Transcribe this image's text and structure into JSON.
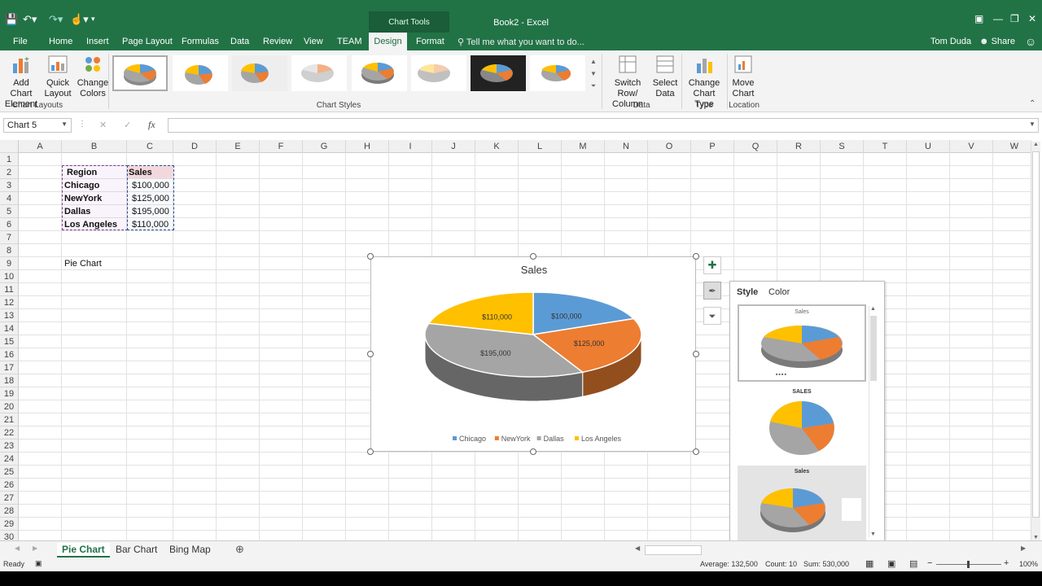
{
  "window": {
    "title": "Book2 - Excel",
    "context_group": "Chart Tools",
    "user": "Tom Duda",
    "share_label": "Share"
  },
  "tabs": [
    {
      "label": "File"
    },
    {
      "label": "Home"
    },
    {
      "label": "Insert"
    },
    {
      "label": "Page Layout"
    },
    {
      "label": "Formulas"
    },
    {
      "label": "Data"
    },
    {
      "label": "Review"
    },
    {
      "label": "View"
    },
    {
      "label": "TEAM"
    },
    {
      "label": "Design"
    },
    {
      "label": "Format"
    }
  ],
  "tell_me": "Tell me what you want to do...",
  "ribbon": {
    "add_chart_element": "Add Chart Element",
    "quick_layout": "Quick Layout",
    "change_colors": "Change Colors",
    "group_chart_layouts": "Chart Layouts",
    "group_chart_styles": "Chart Styles",
    "switch_row_column": "Switch Row/ Column",
    "select_data": "Select Data",
    "group_data": "Data",
    "change_chart_type": "Change Chart Type",
    "group_type": "Type",
    "move_chart": "Move Chart",
    "group_location": "Location"
  },
  "formula_bar": {
    "name_box": "Chart 5",
    "fx": "fx",
    "content": ""
  },
  "columns": [
    "A",
    "B",
    "C",
    "D",
    "E",
    "F",
    "G",
    "H",
    "I",
    "J",
    "K",
    "L",
    "M",
    "N",
    "O",
    "P",
    "Q",
    "R",
    "S",
    "T",
    "U",
    "V",
    "W"
  ],
  "rows": [
    "1",
    "2",
    "3",
    "4",
    "5",
    "6",
    "7",
    "8",
    "9",
    "10",
    "11",
    "12",
    "13",
    "14",
    "15",
    "16",
    "17",
    "18",
    "19",
    "20",
    "21",
    "22",
    "23",
    "24",
    "25",
    "26",
    "27",
    "28",
    "29",
    "30"
  ],
  "table": {
    "header_region": "Region",
    "header_sales": "Sales",
    "rows": [
      {
        "region": "Chicago",
        "sales": "$100,000"
      },
      {
        "region": "NewYork",
        "sales": "$125,000"
      },
      {
        "region": "Dallas",
        "sales": "$195,000"
      },
      {
        "region": "Los Angeles",
        "sales": "$110,000"
      }
    ]
  },
  "note_a9": "Pie Chart",
  "chart_data": {
    "type": "pie",
    "title": "Sales",
    "categories": [
      "Chicago",
      "NewYork",
      "Dallas",
      "Los Angeles"
    ],
    "values": [
      100000,
      125000,
      195000,
      110000
    ],
    "data_labels": [
      "$100,000",
      "$125,000",
      "$195,000",
      "$110,000"
    ],
    "colors": [
      "#5b9bd5",
      "#ed7d31",
      "#a5a5a5",
      "#ffc000"
    ],
    "legend_position": "bottom",
    "style": "3-D"
  },
  "style_panel": {
    "tab_style": "Style",
    "tab_color": "Color",
    "thumb2_title": "SALES",
    "thumb3_title": "Sales",
    "thumb1_title": "Sales"
  },
  "sheets": [
    {
      "label": "Pie Chart",
      "active": true
    },
    {
      "label": "Bar Chart",
      "active": false
    },
    {
      "label": "Bing Map",
      "active": false
    }
  ],
  "status": {
    "ready": "Ready",
    "average": "Average: 132,500",
    "count": "Count: 10",
    "sum": "Sum: 530,000",
    "zoom": "100%"
  }
}
